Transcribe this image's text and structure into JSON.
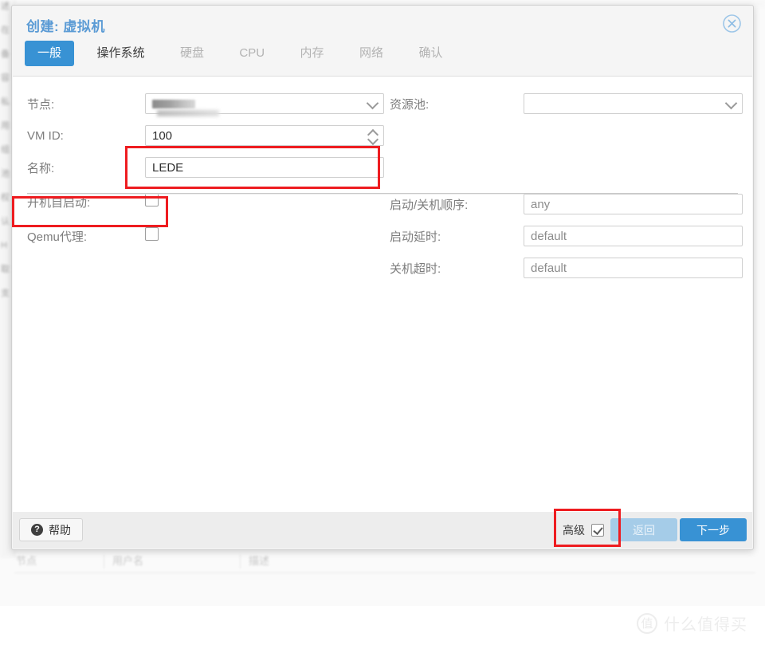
{
  "dialog": {
    "title": "创建: 虚拟机",
    "close_icon": "close-circle-icon",
    "tabs": [
      {
        "label": "一般",
        "state": "active"
      },
      {
        "label": "操作系统",
        "state": "enabled"
      },
      {
        "label": "硬盘",
        "state": "disabled"
      },
      {
        "label": "CPU",
        "state": "disabled"
      },
      {
        "label": "内存",
        "state": "disabled"
      },
      {
        "label": "网络",
        "state": "disabled"
      },
      {
        "label": "确认",
        "state": "disabled"
      }
    ]
  },
  "form": {
    "left": {
      "node_label": "节点:",
      "node_value": "",
      "vmid_label": "VM ID:",
      "vmid_value": "100",
      "name_label": "名称:",
      "name_value": "LEDE",
      "autostart_label": "开机自启动:",
      "autostart_checked": false,
      "qemu_agent_label": "Qemu代理:",
      "qemu_agent_checked": false
    },
    "right": {
      "pool_label": "资源池:",
      "pool_value": "",
      "startorder_label": "启动/关机顺序:",
      "startorder_value": "any",
      "startupdelay_label": "启动延时:",
      "startupdelay_value": "default",
      "shutdowntimeout_label": "关机超时:",
      "shutdowntimeout_value": "default"
    }
  },
  "footer": {
    "help_label": "帮助",
    "help_icon": "question-mark-icon",
    "advanced_label": "高级",
    "advanced_checked": true,
    "back_label": "返回",
    "next_label": "下一步"
  },
  "background": {
    "sidebar_items": [
      "述",
      "在",
      "备",
      "容",
      "私",
      "用",
      "组",
      "池",
      "权",
      "认",
      "H",
      "取",
      "支"
    ],
    "table_headers": [
      "节点",
      "用户名",
      "描述"
    ]
  },
  "watermark": {
    "mark": "值",
    "text": "什么值得买"
  },
  "colors": {
    "accent": "#3892d4",
    "accent_disabled": "#a5cce8",
    "title": "#5b9bd5",
    "annotation": "#ee1c20"
  }
}
